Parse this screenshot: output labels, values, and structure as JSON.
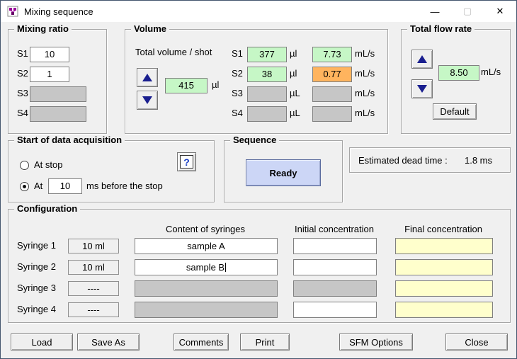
{
  "window": {
    "title": "Mixing sequence",
    "icons": {
      "minimize": "—",
      "maximize": "▢",
      "close": "✕"
    }
  },
  "mixing_ratio": {
    "title": "Mixing ratio",
    "rows": [
      {
        "label": "S1",
        "value": "10"
      },
      {
        "label": "S2",
        "value": "1"
      },
      {
        "label": "S3",
        "value": ""
      },
      {
        "label": "S4",
        "value": ""
      }
    ]
  },
  "volume": {
    "title": "Volume",
    "total_label": "Total volume / shot",
    "total_value": "415",
    "total_unit": "µl",
    "rows": [
      {
        "label": "S1",
        "volume": "377",
        "volume_unit": "µl",
        "flow": "7.73",
        "flow_unit": "mL/s"
      },
      {
        "label": "S2",
        "volume": "38",
        "volume_unit": "µl",
        "flow": "0.77",
        "flow_unit": "mL/s"
      },
      {
        "label": "S3",
        "volume": "",
        "volume_unit": "µL",
        "flow": "",
        "flow_unit": "mL/s"
      },
      {
        "label": "S4",
        "volume": "",
        "volume_unit": "µL",
        "flow": "",
        "flow_unit": "mL/s"
      }
    ]
  },
  "total_flow_rate": {
    "title": "Total flow rate",
    "value": "8.50",
    "unit": "mL/s",
    "default_button": "Default"
  },
  "acquisition": {
    "title": "Start of data acquisition",
    "at_stop_label": "At stop",
    "at_label": "At",
    "at_value": "10",
    "at_suffix": "ms before the stop",
    "help_icon": "?"
  },
  "sequence": {
    "title": "Sequence",
    "ready_button": "Ready"
  },
  "dead_time": {
    "label": "Estimated dead time :",
    "value": "1.8 ms"
  },
  "configuration": {
    "title": "Configuration",
    "headers": {
      "content": "Content of syringes",
      "initial": "Initial concentration",
      "final": "Final concentration"
    },
    "rows": [
      {
        "label": "Syringe 1",
        "size": "10 ml",
        "content": "sample A"
      },
      {
        "label": "Syringe 2",
        "size": "10 ml",
        "content": "sample B"
      },
      {
        "label": "Syringe 3",
        "size": "----",
        "content": ""
      },
      {
        "label": "Syringe 4",
        "size": "----",
        "content": ""
      }
    ]
  },
  "footer": {
    "load": "Load",
    "save_as": "Save As",
    "comments": "Comments",
    "print": "Print",
    "sfm_options": "SFM Options",
    "close": "Close"
  },
  "colors": {
    "field_green": "#c6f7c6",
    "field_orange": "#ffb45e",
    "field_yellow": "#ffffcc",
    "field_disabled": "#c6c6c6",
    "ready_blue": "#ccd6f6",
    "arrow_blue": "#1a1f8f"
  }
}
